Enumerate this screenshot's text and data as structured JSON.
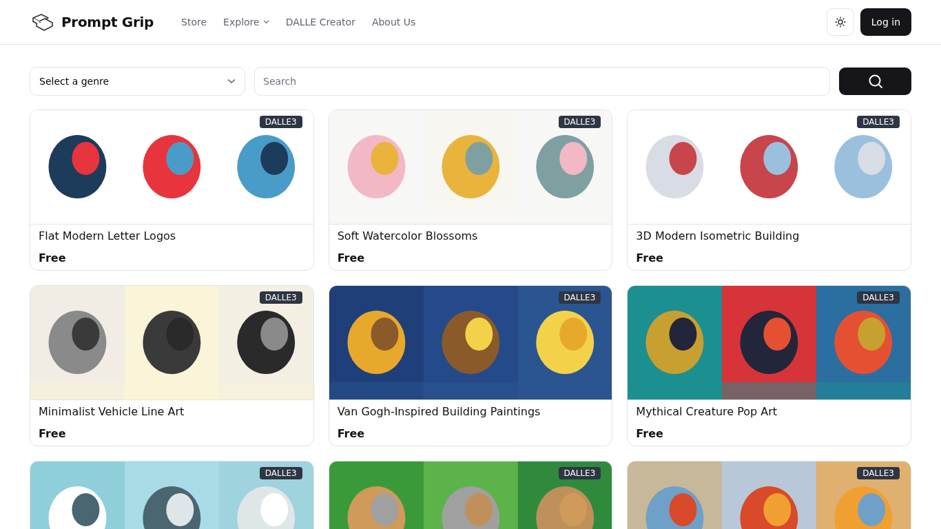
{
  "header": {
    "brand": "Prompt Grip",
    "nav": [
      {
        "label": "Store",
        "kind": "link"
      },
      {
        "label": "Explore",
        "kind": "dropdown"
      },
      {
        "label": "DALLE Creator",
        "kind": "link"
      },
      {
        "label": "About Us",
        "kind": "link"
      }
    ],
    "login": "Log in"
  },
  "filters": {
    "genre": "Select a genre",
    "search_placeholder": "Search"
  },
  "cards": [
    {
      "badge": "DALLE3",
      "title": "Flat Modern Letter Logos",
      "price": "Free"
    },
    {
      "badge": "DALLE3",
      "title": "Soft Watercolor Blossoms",
      "price": "Free"
    },
    {
      "badge": "DALLE3",
      "title": "3D Modern Isometric Building",
      "price": "Free"
    },
    {
      "badge": "DALLE3",
      "title": "Minimalist Vehicle Line Art",
      "price": "Free"
    },
    {
      "badge": "DALLE3",
      "title": "Van Gogh-Inspired Building Paintings",
      "price": "Free"
    },
    {
      "badge": "DALLE3",
      "title": "Mythical Creature Pop Art",
      "price": "Free"
    },
    {
      "badge": "DALLE3"
    },
    {
      "badge": "DALLE3"
    },
    {
      "badge": "DALLE3"
    }
  ]
}
